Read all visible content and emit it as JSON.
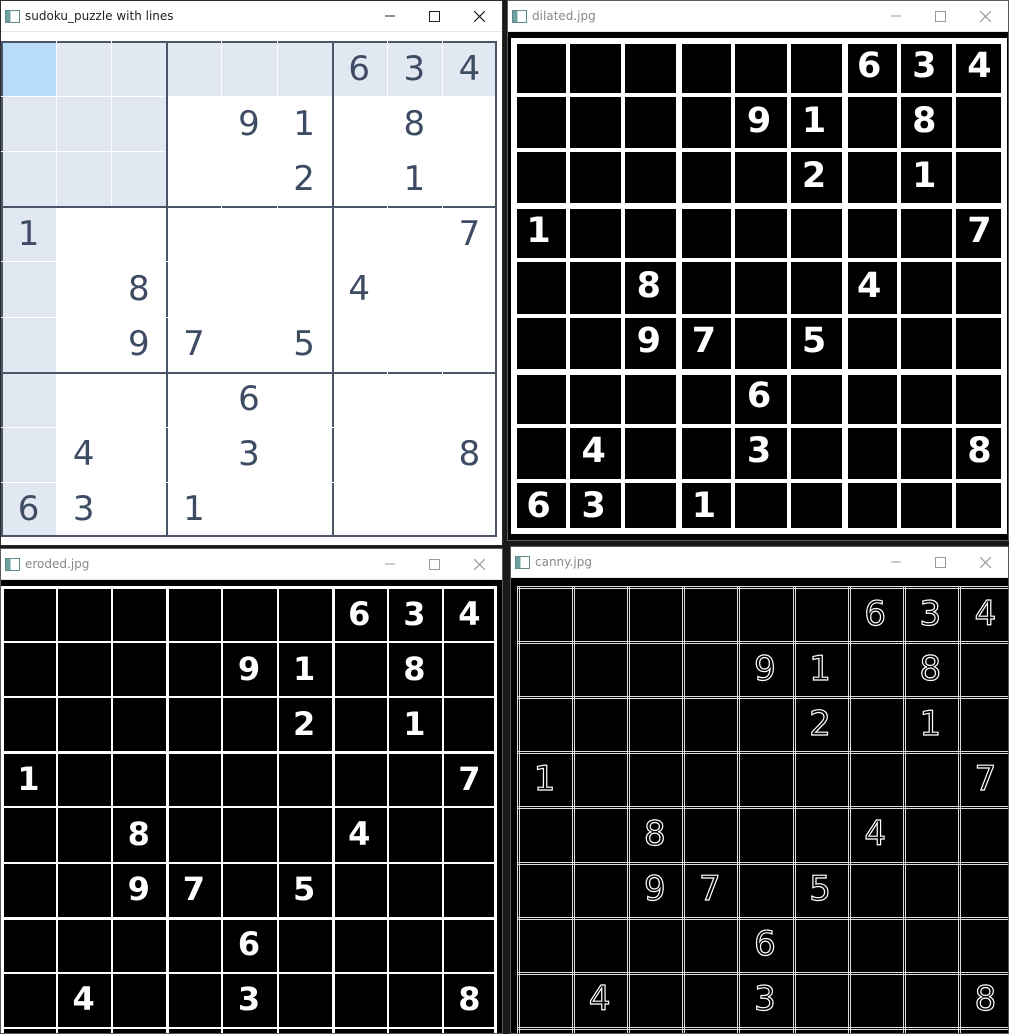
{
  "sudoku": {
    "rows": [
      [
        "",
        "",
        "",
        "",
        "",
        "",
        "6",
        "3",
        "4"
      ],
      [
        "",
        "",
        "",
        "",
        "9",
        "1",
        "",
        "8",
        ""
      ],
      [
        "",
        "",
        "",
        "",
        "",
        "2",
        "",
        "1",
        ""
      ],
      [
        "1",
        "",
        "",
        "",
        "",
        "",
        "",
        "",
        "7"
      ],
      [
        "",
        "",
        "8",
        "",
        "",
        "",
        "4",
        "",
        ""
      ],
      [
        "",
        "",
        "9",
        "7",
        "",
        "5",
        "",
        "",
        ""
      ],
      [
        "",
        "",
        "",
        "",
        "6",
        "",
        "",
        "",
        ""
      ],
      [
        "",
        "4",
        "",
        "",
        "3",
        "",
        "",
        "",
        "8"
      ],
      [
        "6",
        "3",
        "",
        "1",
        "",
        "",
        "",
        "",
        ""
      ]
    ]
  },
  "windows": {
    "puzzle": {
      "title": "sudoku_puzzle with lines"
    },
    "dilated": {
      "title": "dilated.jpg"
    },
    "eroded": {
      "title": "eroded.jpg"
    },
    "canny": {
      "title": "canny.jpg"
    }
  },
  "colors": {
    "selected_cell": "#b8dcf8",
    "highlight_cell": "#e2e8f2",
    "puzzle_digit": "#3d4b63",
    "grid_line": "#4a5668"
  },
  "icons": [
    "app-icon",
    "minimize-icon",
    "maximize-icon",
    "close-icon"
  ]
}
